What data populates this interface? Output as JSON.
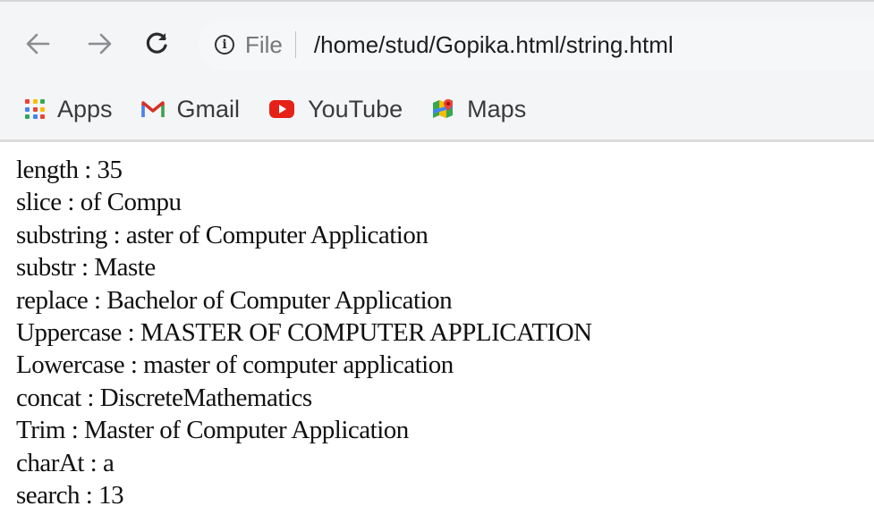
{
  "browser": {
    "address_bar": {
      "scheme_label": "File",
      "url": "/home/stud/Gopika.html/string.html"
    },
    "bookmarks": [
      {
        "label": "Apps",
        "icon": "apps-grid-icon"
      },
      {
        "label": "Gmail",
        "icon": "gmail-icon"
      },
      {
        "label": "YouTube",
        "icon": "youtube-icon"
      },
      {
        "label": "Maps",
        "icon": "maps-icon"
      }
    ]
  },
  "page": {
    "lines": [
      "length : 35",
      "slice : of Compu",
      "substring : aster of Computer Application",
      "substr : Maste",
      "replace : Bachelor of Computer Application",
      "Uppercase : MASTER OF COMPUTER APPLICATION",
      "Lowercase : master of computer application",
      "concat : DiscreteMathematics",
      "Trim : Master of Computer Application",
      "charAt : a",
      "search : 13"
    ]
  },
  "colors": {
    "gmail_red": "#d93025",
    "youtube_red": "#e62117",
    "text": "#111111",
    "chrome_bg": "#f4f5f7"
  }
}
